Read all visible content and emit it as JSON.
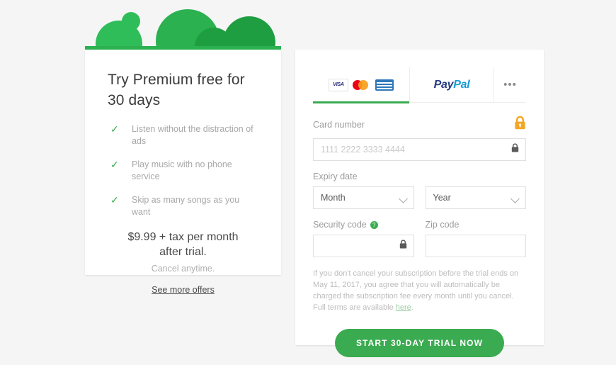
{
  "colors": {
    "background": "#f5f5f5",
    "brand_green": "#3aab50",
    "hero_green_light": "#2fbd5a",
    "hero_green_mid": "#2bb14f",
    "hero_green_dark": "#1f9e41",
    "lock_orange": "#f5a623",
    "paypal_dark": "#253b80",
    "paypal_light": "#179bd7"
  },
  "left_card": {
    "hero_icon": "trees-illustration",
    "title": "Try Premium free for 30 days",
    "features": [
      {
        "check_icon": "check-icon",
        "text": "Listen without the distraction of ads"
      },
      {
        "check_icon": "check-icon",
        "text": "Play music with no phone service"
      },
      {
        "check_icon": "check-icon",
        "text": "Skip as many songs as you want"
      }
    ],
    "price_text": "$9.99 + tax per month after trial.",
    "cancel_text": "Cancel anytime.",
    "see_more_offers": "See more offers"
  },
  "right_card": {
    "tabs": [
      {
        "id": "card",
        "label": "",
        "icons": [
          "visa-logo",
          "mastercard-logo",
          "amex-logo"
        ],
        "active": true
      },
      {
        "id": "paypal",
        "label_part1": "Pay",
        "label_part2": "Pal",
        "icons": [
          "paypal-logo"
        ],
        "active": false
      },
      {
        "id": "more",
        "label": "•••",
        "icons": [
          "more-options-icon"
        ],
        "active": false
      }
    ],
    "card_number": {
      "label": "Card number",
      "placeholder": "1111 2222 3333 4444",
      "value": "",
      "header_icon": "padlock-icon-orange",
      "field_icon": "padlock-icon"
    },
    "expiry": {
      "label": "Expiry date",
      "month": {
        "value": "Month",
        "icon": "chevron-down-icon"
      },
      "year": {
        "value": "Year",
        "icon": "chevron-down-icon"
      }
    },
    "security_code": {
      "label": "Security code",
      "help_icon": "help-badge-icon",
      "help_glyph": "?",
      "value": "",
      "placeholder": "",
      "field_icon": "padlock-icon"
    },
    "zip_code": {
      "label": "Zip code",
      "value": "",
      "placeholder": ""
    },
    "disclaimer": {
      "text": "If you don't cancel your subscription before the trial ends on May 11, 2017, you agree that you will automatically be charged the subscription fee every month until you cancel. Full terms are available ",
      "link_text": "here",
      "suffix": "."
    },
    "cta_label": "START 30-DAY TRIAL NOW"
  }
}
